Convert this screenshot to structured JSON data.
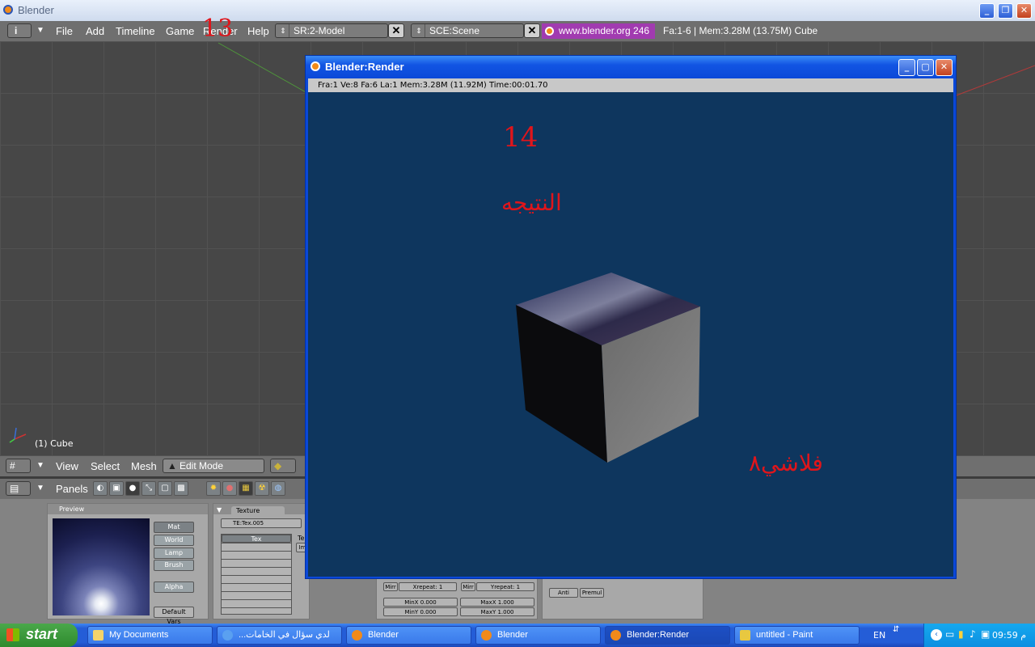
{
  "window": {
    "title": "Blender"
  },
  "header": {
    "menus": [
      "File",
      "Add",
      "Timeline",
      "Game",
      "Render",
      "Help"
    ],
    "screen_field": "SR:2-Model",
    "scene_field": "SCE:Scene",
    "website": "www.blender.org 246",
    "stats": "Fa:1-6 | Mem:3.28M (13.75M) Cube"
  },
  "annotations": {
    "n13": "13",
    "n14": "14",
    "result": "النتيجه",
    "signature": "فلاشي٨"
  },
  "viewport": {
    "object_label": "(1) Cube"
  },
  "view3d_header": {
    "menus": [
      "View",
      "Select",
      "Mesh"
    ],
    "mode": "Edit Mode"
  },
  "buttons_header": {
    "panels_label": "Panels"
  },
  "preview_panel": {
    "title": "Preview",
    "buttons": [
      "Mat",
      "World",
      "Lamp",
      "Brush"
    ],
    "alpha": "Alpha",
    "default_vars": "Default Vars"
  },
  "texture_panel": {
    "title": "Texture",
    "field": "TE:Tex.005",
    "list_header": "Tex",
    "side_t": "Te",
    "side_i": "Im"
  },
  "map_panel": {
    "mirr": "Mirr",
    "xrepeat": "Xrepeat: 1",
    "yrepeat": "Yrepeat: 1",
    "minx": "MinX 0.000",
    "maxx": "MaxX 1.000",
    "miny": "MinY 0.000",
    "maxy": "MaxY 1.000"
  },
  "anti_panel": {
    "anti": "Anti",
    "premul": "Premul"
  },
  "render_window": {
    "title": "Blender:Render",
    "status": "Fra:1  Ve:8 Fa:6 La:1 Mem:3.28M (11.92M) Time:00:01.70"
  },
  "taskbar": {
    "start": "start",
    "tasks": [
      {
        "label": "My Documents",
        "active": false
      },
      {
        "label": "...لدي سؤال في الخامات",
        "active": false
      },
      {
        "label": "Blender",
        "active": false
      },
      {
        "label": "Blender",
        "active": false
      },
      {
        "label": "Blender:Render",
        "active": true
      },
      {
        "label": "untitled - Paint",
        "active": false
      }
    ],
    "lang": "EN",
    "clock": "09:59 م"
  }
}
